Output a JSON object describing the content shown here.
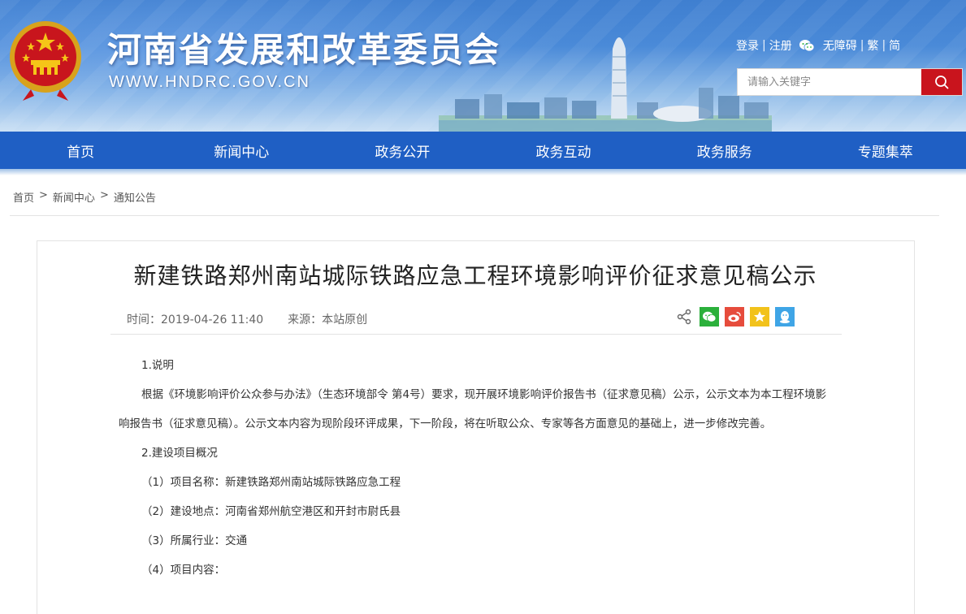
{
  "header": {
    "site_title": "河南省发展和改革委员会",
    "site_url": "WWW.HNDRC.GOV.CN",
    "links": {
      "login": "登录",
      "register": "注册",
      "accessibility": "无障碍",
      "traditional": "繁",
      "simplified": "简"
    },
    "search": {
      "placeholder": "请输入关键字"
    }
  },
  "nav": [
    "首页",
    "新闻中心",
    "政务公开",
    "政务互动",
    "政务服务",
    "专题集萃"
  ],
  "breadcrumb": [
    "首页",
    "新闻中心",
    "通知公告"
  ],
  "article": {
    "title": "新建铁路郑州南站城际铁路应急工程环境影响评价征求意见稿公示",
    "time_label": "时间：",
    "time": "2019-04-26 11:40",
    "source_label": "来源：",
    "source": "本站原创",
    "share_icons": [
      "share-icon",
      "wechat-icon",
      "weibo-icon",
      "favorite-icon",
      "qq-icon"
    ],
    "paragraphs": [
      "1.说明",
      "根据《环境影响评价公众参与办法》（生态环境部令 第4号）要求，现开展环境影响评价报告书（征求意见稿）公示，公示文本为本工程环境影响报告书（征求意见稿）。公示文本内容为现阶段环评成果，下一阶段，将在听取公众、专家等各方面意见的基础上，进一步修改完善。",
      "2.建设项目概况",
      "（1）项目名称：新建铁路郑州南站城际铁路应急工程",
      "（2）建设地点：河南省郑州航空港区和开封市尉氏县",
      "（3）所属行业：交通",
      "（4）项目内容："
    ]
  },
  "colors": {
    "nav_bg": "#1f5fc4",
    "search_button": "#c9141d",
    "wechat": "#2bb03b",
    "weibo": "#e64c3c",
    "favorite": "#f2c21b",
    "qq": "#3fa5e6"
  }
}
